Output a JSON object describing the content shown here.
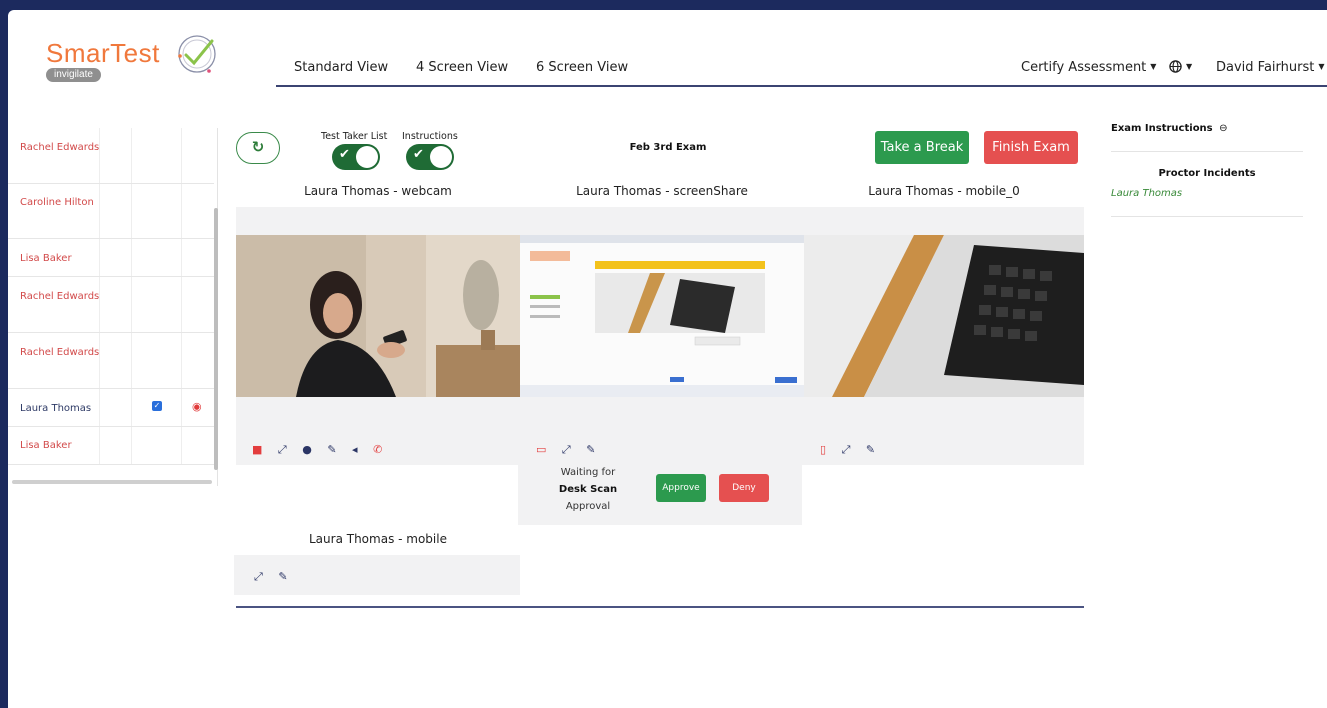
{
  "brand": {
    "name": "SmarTest",
    "subtitle": "invigilate",
    "accent_color": "#f0783c"
  },
  "nav": {
    "views": [
      "Standard View",
      "4 Screen View",
      "6 Screen View"
    ],
    "assessment_menu": "Certify Assessment",
    "language_icon": "globe-icon",
    "user_menu": "David Fairhurst"
  },
  "test_takers": [
    {
      "name": "Rachel Edwards",
      "checked": false,
      "watching": false
    },
    {
      "name": "Caroline Hilton",
      "checked": false,
      "watching": false
    },
    {
      "name": "Lisa Baker",
      "checked": false,
      "watching": false
    },
    {
      "name": "Rachel Edwards",
      "checked": false,
      "watching": false
    },
    {
      "name": "Rachel Edwards",
      "checked": false,
      "watching": false
    },
    {
      "name": "Laura Thomas",
      "checked": true,
      "watching": true
    },
    {
      "name": "Lisa Baker",
      "checked": false,
      "watching": false
    }
  ],
  "controls": {
    "refresh_icon": "refresh-icon",
    "toggle_test_taker_list": "Test Taker List",
    "toggle_instructions": "Instructions",
    "exam_name": "Feb 3rd Exam",
    "take_break": "Take a Break",
    "finish_exam": "Finish Exam"
  },
  "feeds": {
    "webcam": "Laura Thomas - webcam",
    "screenshare": "Laura Thomas - screenShare",
    "mobile_0": "Laura Thomas - mobile_0",
    "mobile": "Laura Thomas - mobile"
  },
  "desk_scan": {
    "line1": "Waiting for",
    "line2": "Desk Scan",
    "line3": "Approval",
    "approve": "Approve",
    "deny": "Deny"
  },
  "right_panel": {
    "exam_instructions": "Exam Instructions",
    "proctor_incidents": "Proctor Incidents",
    "incident_user": "Laura Thomas"
  }
}
